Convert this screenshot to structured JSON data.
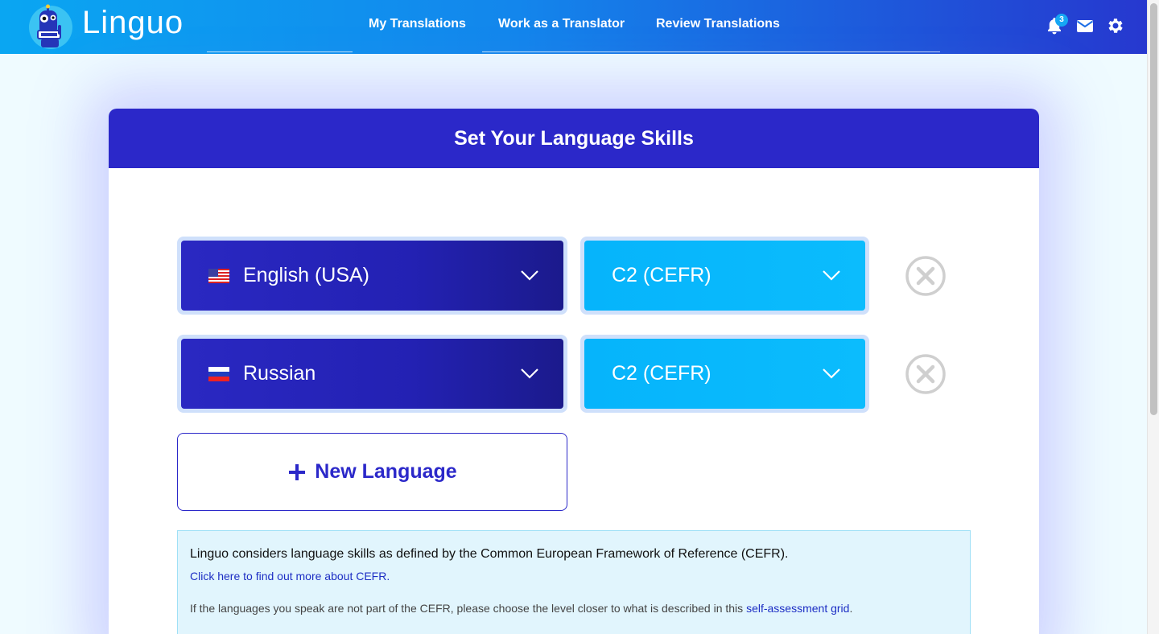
{
  "app": {
    "name": "Linguo",
    "logo_caption": "Linguo"
  },
  "nav": {
    "items": [
      {
        "label": "My Translations"
      },
      {
        "label": "Work as a Translator"
      },
      {
        "label": "Review Translations"
      }
    ]
  },
  "toolbar": {
    "notification_count": "3",
    "icons": [
      "bell-icon",
      "envelope-icon",
      "gear-icon"
    ]
  },
  "page": {
    "title": "Set Your Language Skills"
  },
  "languages": [
    {
      "language": "English (USA)",
      "flag": "us-flag-icon",
      "level": "C2 (CEFR)"
    },
    {
      "language": "Russian",
      "flag": "ru-flag-icon",
      "level": "C2 (CEFR)"
    }
  ],
  "new_language": {
    "label": "New Language"
  },
  "info": {
    "main": "Linguo considers language skills as defined by the Common European Framework of Reference (CEFR).",
    "link": "Click here to find out more about CEFR.",
    "para_text": "If the languages you speak are not part of the CEFR, please choose the level closer to what is described in this ",
    "para_link": "self-assessment grid",
    "para_end": "."
  },
  "colors": {
    "topbar_start": "#0aa6f2",
    "topbar_end": "#2638cf",
    "header": "#2b28c9",
    "level_bg": "#06b4fb",
    "link": "#1d2ec4"
  }
}
